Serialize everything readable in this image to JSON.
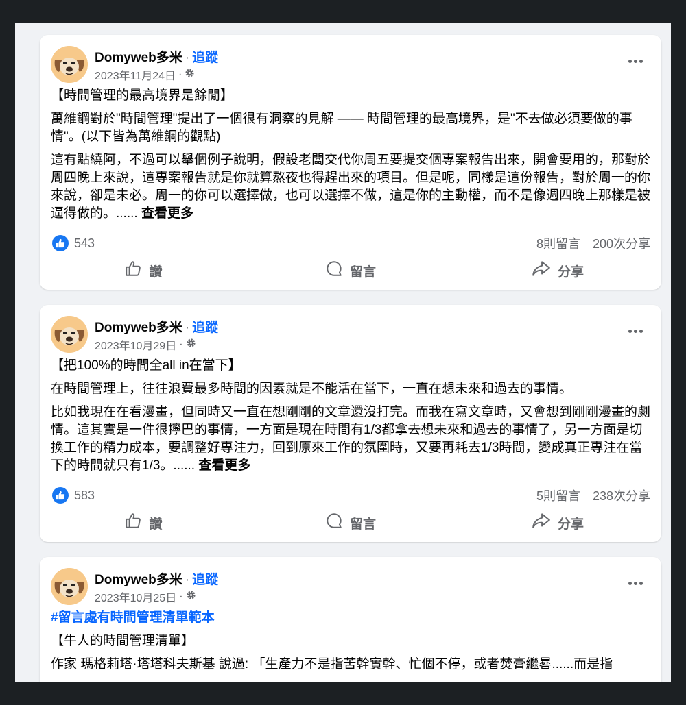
{
  "posts": [
    {
      "author": "Domyweb多米",
      "separator": "·",
      "follow": "追蹤",
      "date": "2023年11月24日",
      "date_sep": "·",
      "hashtag": "",
      "paragraphs": [
        "【時間管理的最高境界是餘閒】",
        "萬維鋼對於\"時間管理\"提出了一個很有洞察的見解 —— 時間管理的最高境界，是\"不去做必須要做的事情\"。(以下皆為萬維鋼的觀點)"
      ],
      "last_paragraph": "這有點繞阿，不過可以舉個例子說明，假設老闆交代你周五要提交個專案報告出來，開會要用的，那對於周四晚上來說，這專案報告就是你就算熬夜也得趕出來的項目。但是呢，同樣是這份報告，對於周一的你來說，卻是未必。周一的你可以選擇做，也可以選擇不做，這是你的主動權，而不是像週四晚上那樣是被逼得做的。......",
      "see_more": "查看更多",
      "likes": "543",
      "comments": "8則留言",
      "shares": "200次分享"
    },
    {
      "author": "Domyweb多米",
      "separator": "·",
      "follow": "追蹤",
      "date": "2023年10月29日",
      "date_sep": "·",
      "hashtag": "",
      "paragraphs": [
        "【把100%的時間全all in在當下】",
        "在時間管理上，往往浪費最多時間的因素就是不能活在當下，一直在想未來和過去的事情。"
      ],
      "last_paragraph": "比如我現在在看漫畫，但同時又一直在想剛剛的文章還沒打完。而我在寫文章時，又會想到剛剛漫畫的劇情。這其實是一件很擰巴的事情，一方面是現在時間有1/3都拿去想未來和過去的事情了，另一方面是切換工作的精力成本，要調整好專注力，回到原來工作的氛圍時，又要再耗去1/3時間，變成真正專注在當下的時間就只有1/3。......",
      "see_more": "查看更多",
      "likes": "583",
      "comments": "5則留言",
      "shares": "238次分享"
    },
    {
      "author": "Domyweb多米",
      "separator": "·",
      "follow": "追蹤",
      "date": "2023年10月25日",
      "date_sep": "·",
      "hashtag": "#留言處有時間管理清單範本",
      "paragraphs": [
        "【牛人的時間管理清單】"
      ],
      "last_paragraph": "作家 瑪格莉塔·塔塔科夫斯基 說過: 「生產力不是指苦幹實幹、忙個不停，或者焚膏繼晷......而是指",
      "see_more": "",
      "likes": "",
      "comments": "",
      "shares": ""
    }
  ],
  "actions": {
    "like": "讚",
    "comment": "留言",
    "share": "分享"
  },
  "icons": {
    "more": "more-horizontal-icon",
    "privacy": "gear-icon",
    "like_badge": "thumbs-up-icon",
    "like": "thumbs-up-outline-icon",
    "comment": "comment-bubble-icon",
    "share": "share-arrow-icon"
  },
  "colors": {
    "accent": "#0866ff",
    "like_badge": "#1877f2",
    "secondary_text": "#65676b",
    "feed_bg": "#f0f2f5"
  }
}
